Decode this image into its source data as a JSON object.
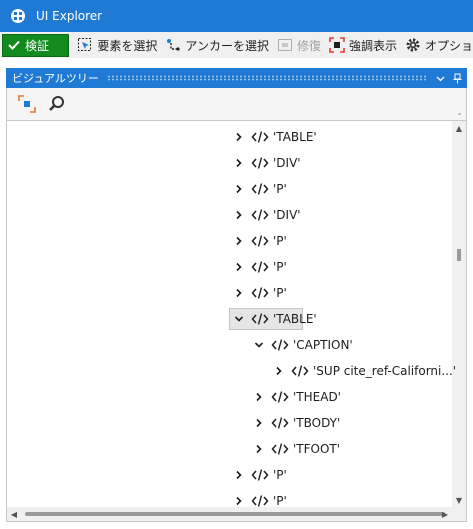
{
  "window": {
    "title": "UI Explorer"
  },
  "toolbar": {
    "validate_label": "検証",
    "select_element_label": "要素を選択",
    "select_anchor_label": "アンカーを選択",
    "repair_label": "修復",
    "highlight_label": "強調表示",
    "options_label": "オプショ"
  },
  "panel": {
    "title": "ビジュアルツリー",
    "header_buttons": [
      "chevron-down-icon",
      "pin-icon"
    ]
  },
  "tree": {
    "items": [
      {
        "label": "'TABLE'",
        "depth": 0,
        "expanded": false,
        "selected": false
      },
      {
        "label": "'DIV'",
        "depth": 0,
        "expanded": false,
        "selected": false
      },
      {
        "label": "'P'",
        "depth": 0,
        "expanded": false,
        "selected": false
      },
      {
        "label": "'DIV'",
        "depth": 0,
        "expanded": false,
        "selected": false
      },
      {
        "label": "'P'",
        "depth": 0,
        "expanded": false,
        "selected": false
      },
      {
        "label": "'P'",
        "depth": 0,
        "expanded": false,
        "selected": false
      },
      {
        "label": "'P'",
        "depth": 0,
        "expanded": false,
        "selected": false
      },
      {
        "label": "'TABLE'",
        "depth": 0,
        "expanded": true,
        "selected": true
      },
      {
        "label": "'CAPTION'",
        "depth": 1,
        "expanded": true,
        "selected": false
      },
      {
        "label": "'SUP  cite_ref-Californi...'",
        "depth": 2,
        "expanded": false,
        "selected": false
      },
      {
        "label": "'THEAD'",
        "depth": 1,
        "expanded": false,
        "selected": false
      },
      {
        "label": "'TBODY'",
        "depth": 1,
        "expanded": false,
        "selected": false
      },
      {
        "label": "'TFOOT'",
        "depth": 1,
        "expanded": false,
        "selected": false
      },
      {
        "label": "'P'",
        "depth": 0,
        "expanded": false,
        "selected": false
      },
      {
        "label": "'P'",
        "depth": 0,
        "expanded": false,
        "selected": false
      }
    ]
  },
  "colors": {
    "accent": "#1f7ad6",
    "validate_green": "#138a1e",
    "selected_row": "#e5e5e5"
  }
}
